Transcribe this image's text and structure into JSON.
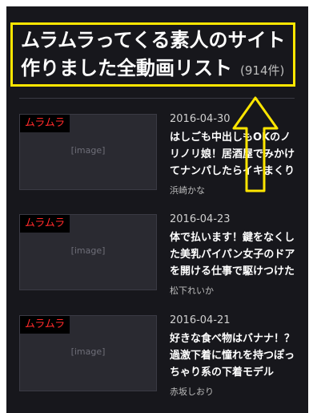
{
  "header": {
    "title": "ムラムラってくる素人のサイト作りました全動画リスト",
    "count": "(914件)"
  },
  "colors": {
    "background": "#17171c",
    "highlight": "#ffe600",
    "tag_text": "#ff2a2a"
  },
  "items": [
    {
      "date": "2016-04-30",
      "title": "はしごも中出しもOKのノリノリ娘！居酒屋でみかけてナンパしたらイキまくり",
      "author": "浜崎かな",
      "tag": "ムラムラ"
    },
    {
      "date": "2016-04-23",
      "title": "体で払います！鍵をなくした美乳パイパン女子のドアを開ける仕事で駆けつけたら",
      "author": "松下れいか",
      "tag": "ムラムラ"
    },
    {
      "date": "2016-04-21",
      "title": "好きな食べ物はバナナ！？過激下着に憧れを持つぽっちゃり系の下着モデル",
      "author": "赤坂しおり",
      "tag": "ムラムラ"
    }
  ]
}
